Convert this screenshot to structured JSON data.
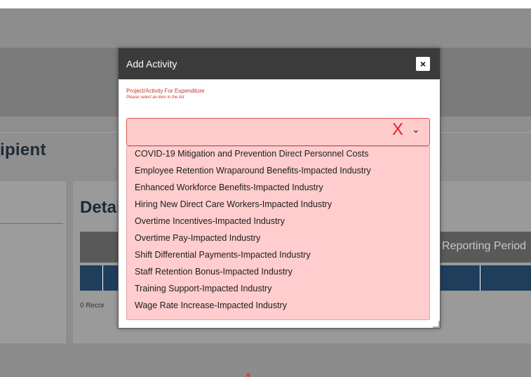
{
  "background": {
    "page_title": "ipient",
    "details_title": "Detai",
    "table_header_label": "Reporting Period",
    "records_text": "0 Recor"
  },
  "modal": {
    "title": "Add Activity",
    "close_label": "×",
    "field_label": "Project/Activity For Expenditure",
    "field_hint": "Please select an item in the list",
    "error_mark": "X",
    "chevron": "⌄",
    "options": [
      "COVID-19 Mitigation and Prevention Direct Personnel Costs",
      "Employee Retention Wraparound Benefits-Impacted Industry",
      "Enhanced Workforce Benefits-Impacted Industry",
      "Hiring New Direct Care Workers-Impacted Industry",
      "Overtime Incentives-Impacted Industry",
      "Overtime Pay-Impacted Industry",
      "Shift Differential Payments-Impacted Industry",
      "Staff Retention Bonus-Impacted Industry",
      "Training Support-Impacted Industry",
      "Wage Rate Increase-Impacted Industry"
    ]
  },
  "colors": {
    "overlay": "#8c8c8c",
    "modal_header": "#3b3b3b",
    "invalid_fill": "#ffcccc",
    "error_red": "#e02424"
  }
}
